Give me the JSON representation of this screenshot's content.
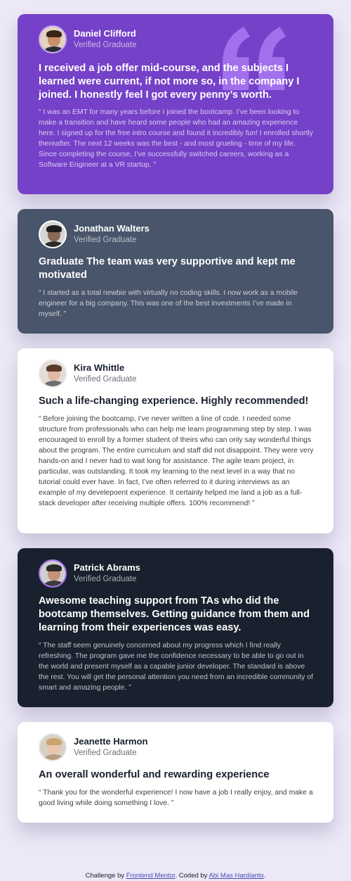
{
  "testimonials": [
    {
      "name": "Daniel Clifford",
      "role": "Verified Graduate",
      "title": "I received a job offer mid-course, and the subjects I learned were current, if not more so, in the company I joined. I honestly feel I got every penny’s worth.",
      "body": "“ I was an EMT for many years before I joined the bootcamp. I’ve been looking to make a transition and have heard some people who had an amazing experience here. I signed up for the free intro course and found it incredibly fun! I enrolled shortly thereafter. The next 12 weeks was the best - and most grueling - time of my life. Since completing the course, I’ve successfully switched careers, working as a Software Engineer at a VR startup. ”",
      "card_color": "#7541C8"
    },
    {
      "name": "Jonathan Walters",
      "role": "Verified Graduate",
      "title": "Graduate The team was very supportive and kept me motivated",
      "body": "“ I started as a total newbie with virtually no coding skills. I now work as a mobile engineer for a big company. This was one of the best investments I’ve made in myself. ”",
      "card_color": "#48556A"
    },
    {
      "name": "Kira Whittle",
      "role": "Verified Graduate",
      "title": "Such a life-changing experience. Highly recommended!",
      "body": "“ Before joining the bootcamp, I’ve never written a line of code. I needed some structure from professionals who can help me learn programming step by step. I was encouraged to enroll by a former student of theirs who can only say wonderful things about the program. The entire curriculum and staff did not disappoint. They were very hands-on and I never had to wait long for assistance. The agile team project, in particular, was outstanding. It took my learning to the next level in a way that no tutorial could ever have. In fact, I’ve often referred to it during interviews as an example of my develepoent experience. It certainly helped me land a job as a full-stack developer after receiving multiple offers. 100% recommend! ”",
      "card_color": "#FFFFFF"
    },
    {
      "name": "Patrick Abrams",
      "role": "Verified Graduate",
      "title": "Awesome teaching support from TAs who did the bootcamp themselves. Getting guidance from them and learning from their experiences was easy.",
      "body": "“ The staff seem genuinely concerned about my progress which I find really refreshing. The program gave me the confidence necessary to be able to go out in the world and present myself as a capable junior developer. The standard is above the rest. You will get the personal attention you need from an incredible community of smart and amazing people. ”",
      "card_color": "#19212E"
    },
    {
      "name": "Jeanette Harmon",
      "role": "Verified Graduate",
      "title": "An overall wonderful and rewarding experience",
      "body": "“ Thank you for the wonderful experience! I now have a job I really enjoy, and make a good living while doing something I love. ”",
      "card_color": "#FFFFFF"
    }
  ],
  "avatars": [
    {
      "icon": "avatar-daniel-icon"
    },
    {
      "icon": "avatar-jonathan-icon"
    },
    {
      "icon": "avatar-kira-icon"
    },
    {
      "icon": "avatar-patrick-icon"
    },
    {
      "icon": "avatar-jeanette-icon"
    }
  ],
  "footer": {
    "prefix": "Challenge by ",
    "link1": "Frontend Mentor",
    "middle": ". Coded by ",
    "link2": "Abi Mas Hardianto",
    "suffix": "."
  },
  "colors": {
    "background": "#ECE8F6",
    "purple": "#7541C8",
    "slate": "#48556A",
    "dark": "#19212E",
    "link": "#4650B8"
  }
}
